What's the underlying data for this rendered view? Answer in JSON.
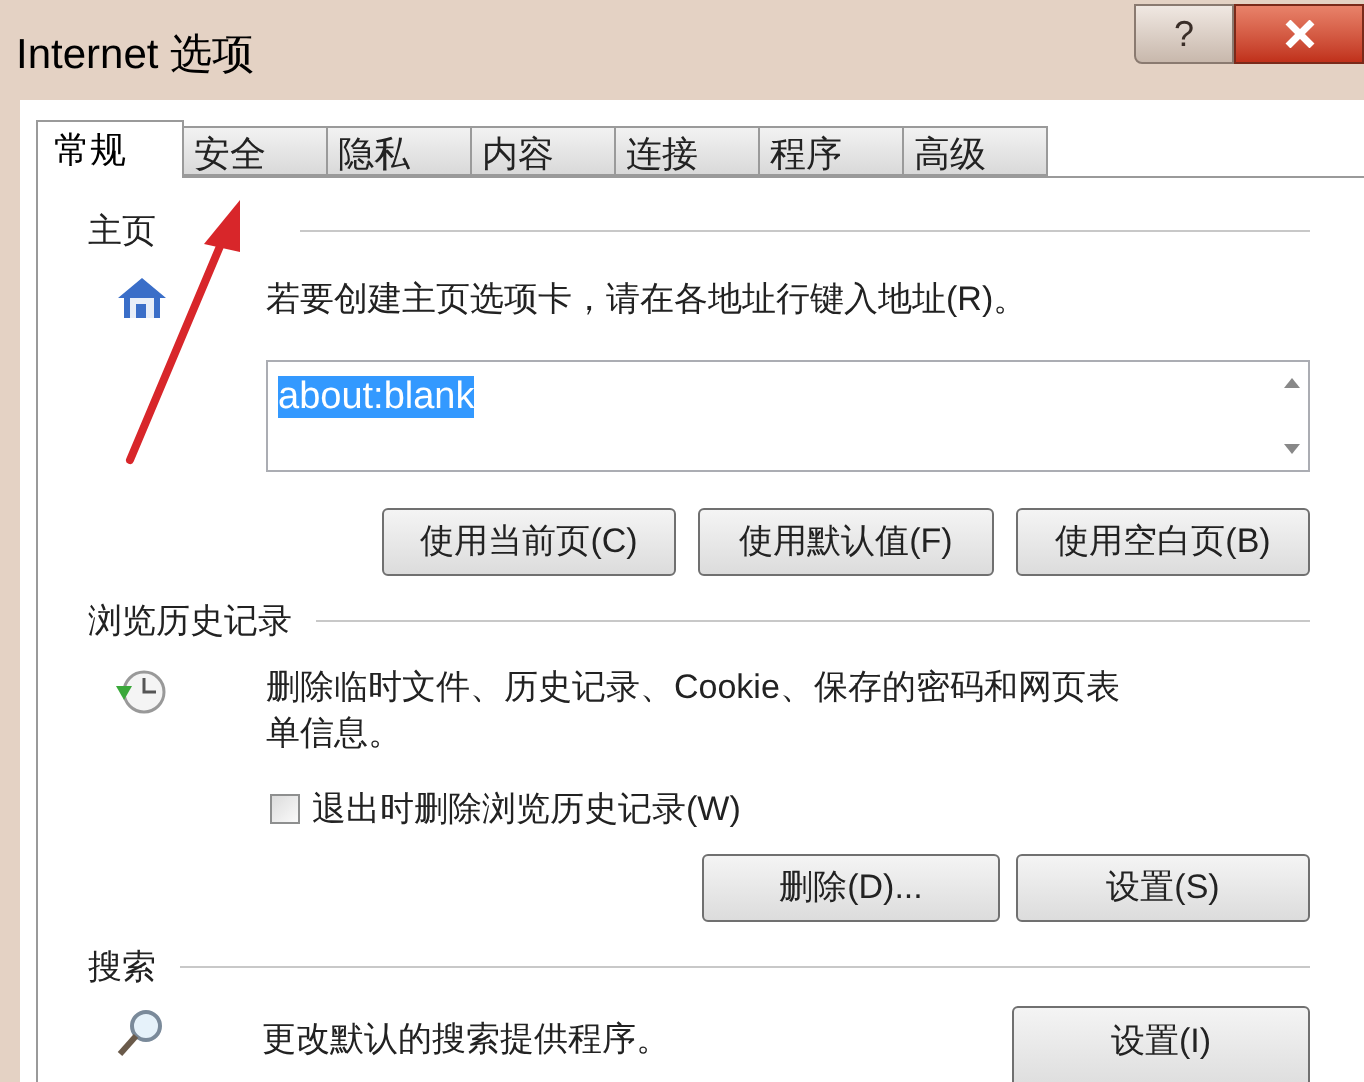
{
  "window": {
    "title": "Internet 选项",
    "help_button": "?"
  },
  "tabs": [
    {
      "label": "常规",
      "selected": true
    },
    {
      "label": "安全",
      "selected": false
    },
    {
      "label": "隐私",
      "selected": false
    },
    {
      "label": "内容",
      "selected": false
    },
    {
      "label": "连接",
      "selected": false
    },
    {
      "label": "程序",
      "selected": false
    },
    {
      "label": "高级",
      "selected": false
    }
  ],
  "homepage": {
    "heading": "主页",
    "instruction": "若要创建主页选项卡，请在各地址行键入地址(R)。",
    "address": {
      "value": "about:blank",
      "selected": true
    },
    "buttons": [
      "使用当前页(C)",
      "使用默认值(F)",
      "使用空白页(B)"
    ]
  },
  "history": {
    "heading": "浏览历史记录",
    "description": "删除临时文件、历史记录、Cookie、保存的密码和网页表单信息。",
    "delete_on_exit": {
      "label": "退出时删除浏览历史记录(W)",
      "checked": false
    },
    "buttons": [
      "删除(D)...",
      "设置(S)"
    ]
  },
  "search": {
    "heading": "搜索",
    "description": "更改默认的搜索提供程序。",
    "buttons": [
      "设置(I)"
    ]
  }
}
